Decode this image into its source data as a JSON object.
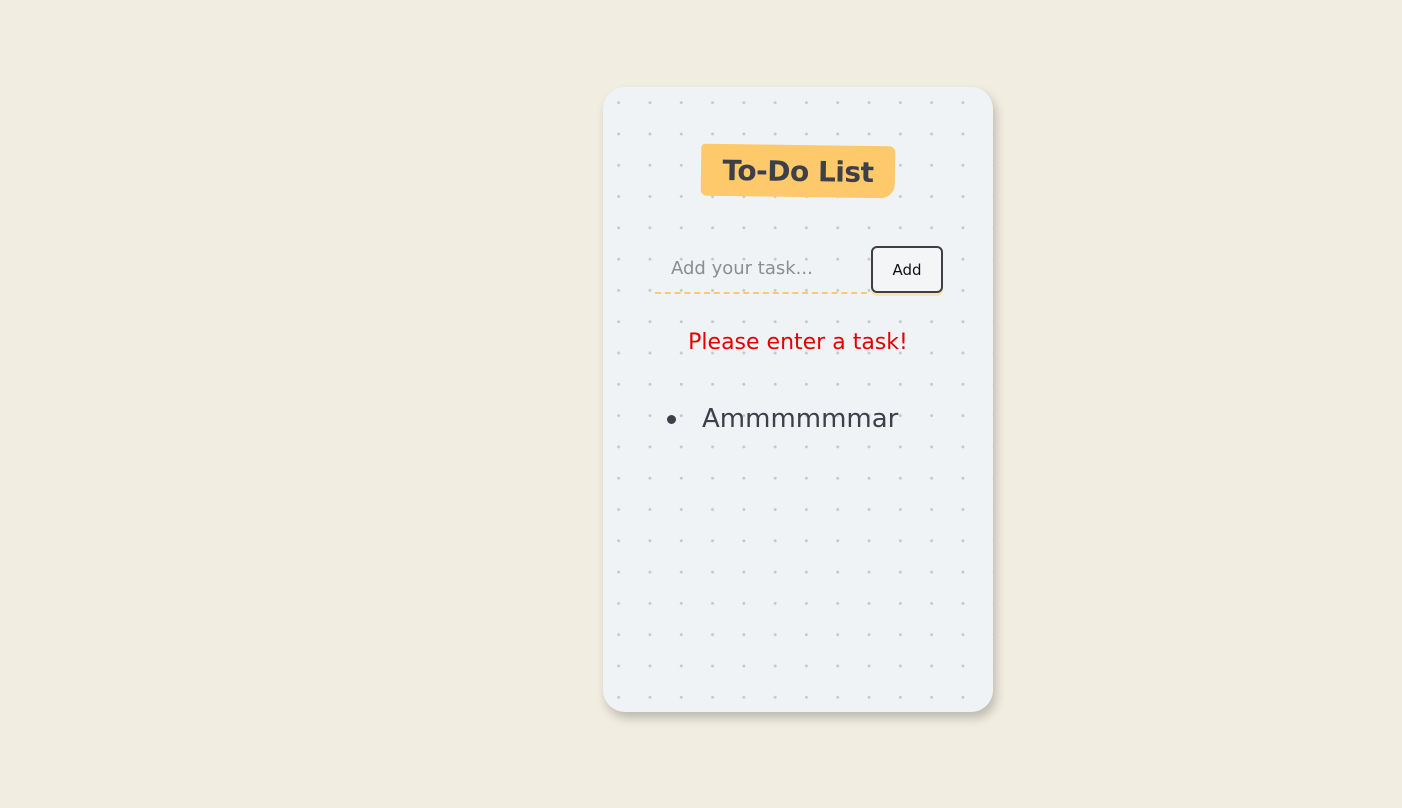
{
  "app": {
    "title": "To-Do List"
  },
  "form": {
    "input_value": "",
    "input_placeholder": "Add your task...",
    "add_button_label": "Add"
  },
  "error": {
    "message": "Please enter a task!"
  },
  "tasks": [
    {
      "text": "Ammmmmmar"
    }
  ],
  "colors": {
    "page_background": "#f1ede0",
    "card_background": "#f0f3f6",
    "accent_yellow": "#fdc96b",
    "error_red": "#e30000",
    "text_dark": "#3d4048"
  },
  "icons": {
    "task_bullet": "bullet-dot-icon"
  }
}
